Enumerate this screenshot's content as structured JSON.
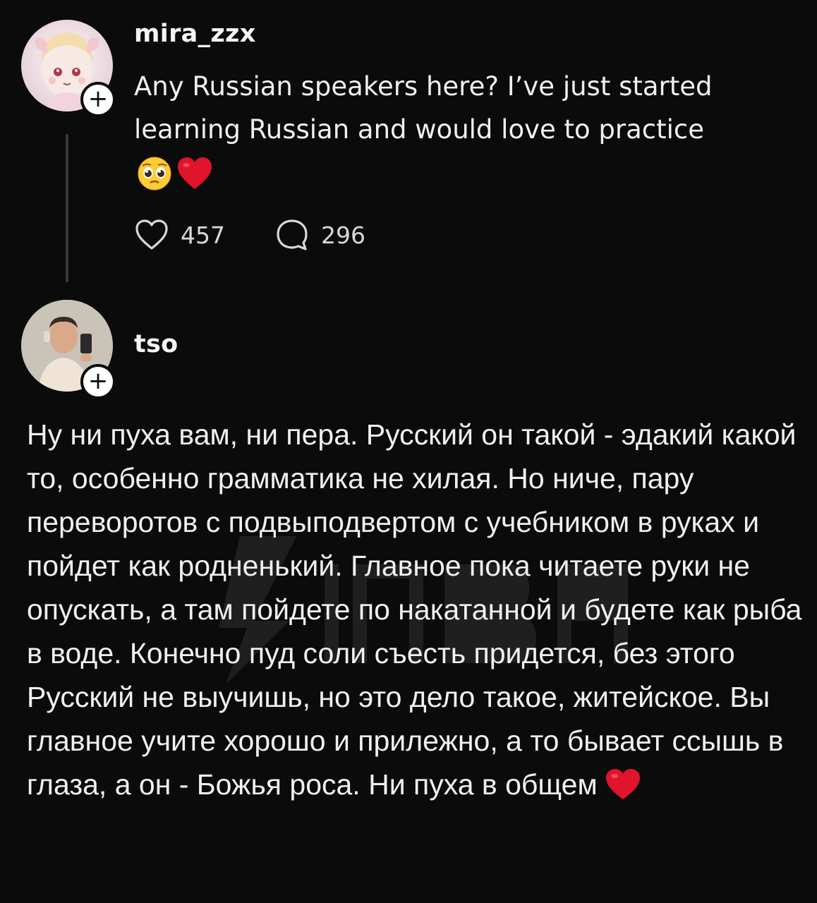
{
  "post": {
    "username": "mira_zzx",
    "text": "Any Russian speakers here? I’ve just started learning Russian and would love to practice",
    "emojis": [
      "pleading-face",
      "red-heart"
    ],
    "likes": "457",
    "comments": "296",
    "follow_symbol": "+"
  },
  "reply": {
    "username": "tso",
    "follow_symbol": "+",
    "text": "Ну ни пуха вам, ни пера. Русский он такой - эдакий какой то, особенно грамматика не хилая. Но ниче, пару переворотов с подвыподвертом с учебником в руках и пойдет как родненький. Главное пока читаете руки не опускать, а там пойдете по накатанной и будете как рыба в воде. Конечно пуд соли съесть придется, без этого Русский не выучишь, но это дело такое, житейское. Вы главное учите хорошо и прилежно, а то бывает ссышь в глаза, а он - Божья роса. Ни пуха в общем",
    "trailing_emoji": "red-heart"
  },
  "colors": {
    "background": "#0b0b0b",
    "text": "#f0f0f0",
    "heart": "#e0142b"
  }
}
